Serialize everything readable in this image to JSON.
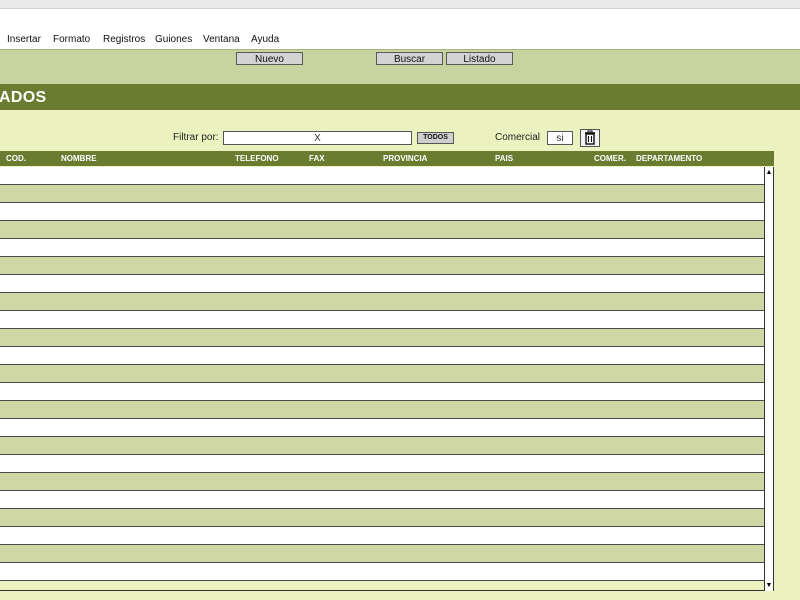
{
  "menu": [
    "Insertar",
    "Formato",
    "Registros",
    "Guiones",
    "Ventana",
    "Ayuda"
  ],
  "toolbar": {
    "nuevo_label": "Nuevo",
    "buscar_label": "Buscar",
    "listado_label": "Listado"
  },
  "page": {
    "title": "ADOS"
  },
  "filter": {
    "label": "Filtrar por:",
    "value": "X",
    "todos_label": "TODOS",
    "comercial_label": "Comercial",
    "comercial_value": "si"
  },
  "table": {
    "columns": [
      "COD.",
      "NOMBRE",
      "TELEFONO",
      "FAX",
      "PROVINCIA",
      "PAIS",
      "COMER.",
      "DEPARTAMENTO"
    ],
    "row_count": 23
  },
  "colors": {
    "header_bg": "#6a7c30",
    "toolbar_bg": "#c8d49f",
    "content_bg": "#ebf2c0",
    "row_alt": "#cfd8a5"
  },
  "icons": {
    "trash": "trash-icon",
    "scroll_up": "scroll-up-arrow-icon",
    "scroll_down": "scroll-down-arrow-icon"
  }
}
